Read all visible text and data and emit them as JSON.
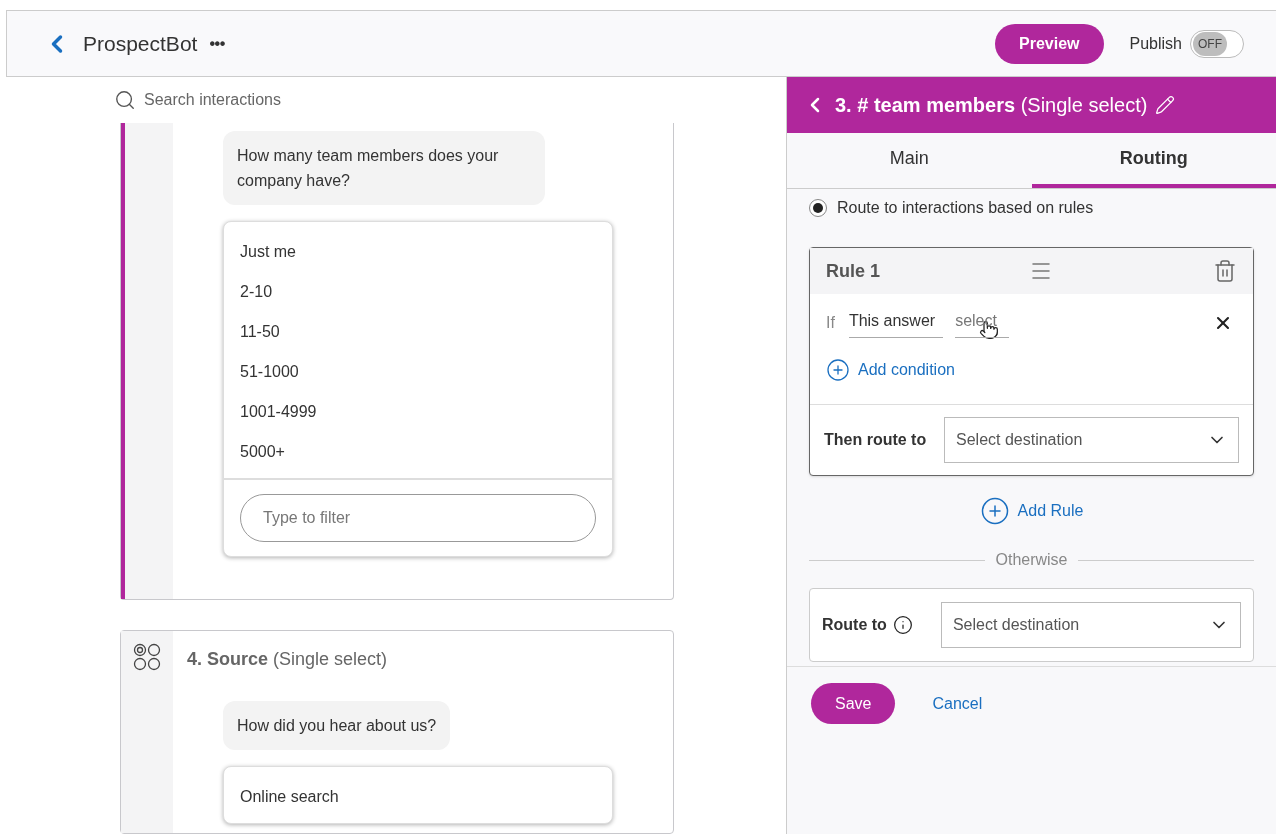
{
  "header": {
    "title": "ProspectBot",
    "more": "•••",
    "preview_button": "Preview",
    "publish_label": "Publish",
    "publish_toggle": {
      "on": false,
      "label": "OFF"
    }
  },
  "search": {
    "placeholder": "Search interactions"
  },
  "interactions": [
    {
      "active": true,
      "question": "How many team members does your company have?",
      "options": [
        "Just me",
        "2-10",
        "11-50",
        "51-1000",
        "1001-4999",
        "5000+"
      ],
      "filter_placeholder": "Type to filter"
    },
    {
      "active": false,
      "title": "**4. Source** (Single select)",
      "question": "How did you hear about us?",
      "options": [
        "Online search"
      ]
    }
  ],
  "panel": {
    "title": "**3. # team members** (Single select)",
    "tabs": [
      {
        "label": "Main",
        "selected": false
      },
      {
        "label": "Routing",
        "selected": true
      }
    ],
    "mode": {
      "label": "Route to interactions based on rules",
      "selected": true
    },
    "rules": [
      {
        "title": "Rule 1",
        "conditions": [
          {
            "prefix": "If",
            "subject": "This answer",
            "operator_placeholder": "select"
          }
        ],
        "add_condition": "Add condition",
        "then_label": "Then route to",
        "destination_placeholder": "Select destination"
      }
    ],
    "add_rule": "Add Rule",
    "otherwise": {
      "label": "Otherwise",
      "route_label": "Route to",
      "destination_placeholder": "Select destination"
    },
    "save_button": "Save",
    "cancel_link": "Cancel"
  }
}
